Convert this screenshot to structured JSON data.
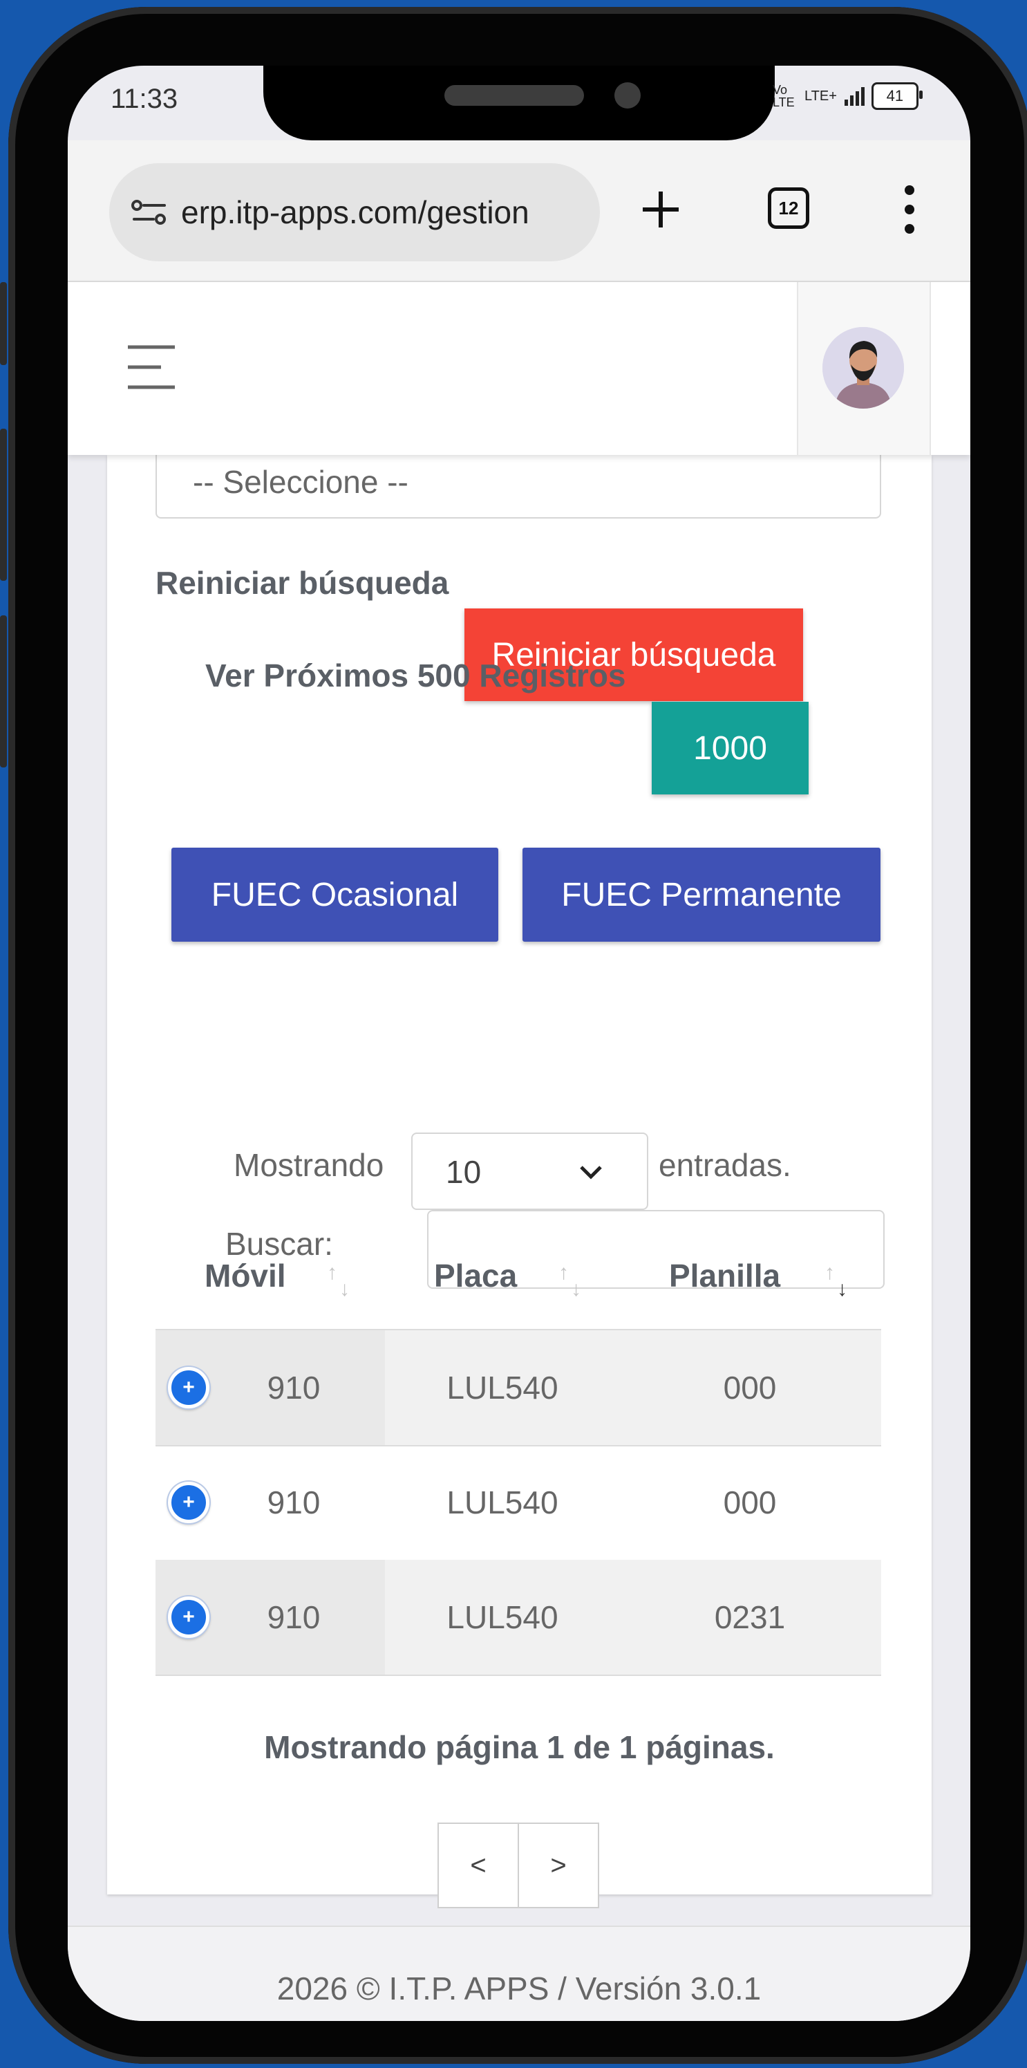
{
  "status_bar": {
    "time": "11:33",
    "network": "Vo LTE",
    "network2": "LTE+",
    "battery": "41"
  },
  "browser": {
    "url": "erp.itp-apps.com/gestion",
    "tab_count": "12"
  },
  "filter": {
    "select_placeholder": "-- Seleccione --",
    "reset_label": "Reiniciar búsqueda",
    "reset_button": "Reiniciar búsqueda",
    "next_records_label": "Ver Próximos 500 Registros",
    "next_records_button": "1000"
  },
  "actions": {
    "fuec_ocasional": "FUEC Ocasional",
    "fuec_permanente": "FUEC Permanente"
  },
  "table_controls": {
    "showing_label": "Mostrando",
    "page_size": "10",
    "entries_label": "entradas.",
    "search_label": "Buscar:",
    "search_value": ""
  },
  "table": {
    "headers": [
      "Móvil",
      "Placa",
      "Planilla"
    ],
    "rows": [
      {
        "movil": "910",
        "placa": "LUL540",
        "planilla": "000"
      },
      {
        "movil": "910",
        "placa": "LUL540",
        "planilla": "000"
      },
      {
        "movil": "910",
        "placa": "LUL540",
        "planilla": "0231"
      }
    ]
  },
  "pagination": {
    "info": "Mostrando página 1 de 1 páginas.",
    "prev": "<",
    "next": ">"
  },
  "footer": {
    "text": "2026 © I.T.P. APPS / Versión 3.0.1"
  },
  "colors": {
    "danger": "#f44336",
    "teal": "#14a197",
    "indigo": "#3f51b5",
    "row_plus": "#1b6fe4"
  }
}
